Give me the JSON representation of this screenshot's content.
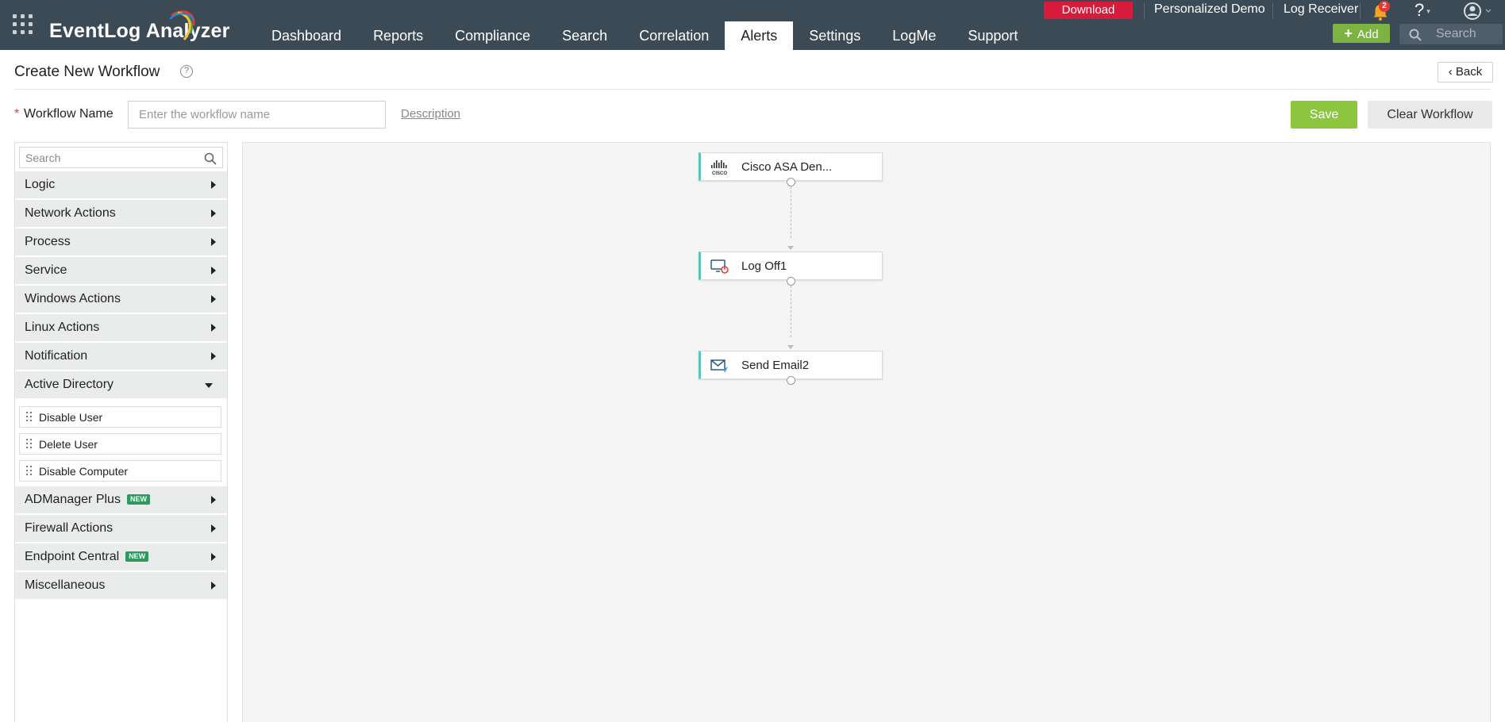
{
  "app": {
    "name": "EventLog Analyzer",
    "accent": "#8cc63f"
  },
  "nav": {
    "tabs": [
      {
        "label": "Dashboard"
      },
      {
        "label": "Reports"
      },
      {
        "label": "Compliance"
      },
      {
        "label": "Search"
      },
      {
        "label": "Correlation"
      },
      {
        "label": "Alerts",
        "active": true
      },
      {
        "label": "Settings"
      },
      {
        "label": "LogMe"
      },
      {
        "label": "Support"
      }
    ]
  },
  "header": {
    "download_label": "Download",
    "personalized_demo": "Personalized Demo",
    "log_receiver": "Log Receiver",
    "notification_count": "2",
    "help_label": "?",
    "add_label": "Add",
    "search_placeholder": "Search"
  },
  "page": {
    "title": "Create New Workflow",
    "help_icon_label": "?",
    "back_label": "Back"
  },
  "form": {
    "required_mark": "*",
    "workflow_name_label": "Workflow Name",
    "workflow_name_value": "",
    "workflow_name_placeholder": "Enter the workflow name",
    "description_link": "Description",
    "save_label": "Save",
    "clear_label": "Clear Workflow"
  },
  "palette": {
    "search_placeholder": "Search",
    "new_badge": "NEW",
    "categories": [
      {
        "label": "Logic",
        "expanded": false
      },
      {
        "label": "Network Actions",
        "expanded": false
      },
      {
        "label": "Process",
        "expanded": false
      },
      {
        "label": "Service",
        "expanded": false
      },
      {
        "label": "Windows Actions",
        "expanded": false
      },
      {
        "label": "Linux Actions",
        "expanded": false
      },
      {
        "label": "Notification",
        "expanded": false
      },
      {
        "label": "Active Directory",
        "expanded": true,
        "items": [
          "Disable User",
          "Delete User",
          "Disable Computer"
        ]
      },
      {
        "label": "ADManager Plus",
        "expanded": false,
        "is_new": true
      },
      {
        "label": "Firewall Actions",
        "expanded": false
      },
      {
        "label": "Endpoint Central",
        "expanded": false,
        "is_new": true
      },
      {
        "label": "Miscellaneous",
        "expanded": false
      }
    ]
  },
  "workflow": {
    "nodes": [
      {
        "label": "Cisco ASA Den...",
        "icon": "cisco-icon"
      },
      {
        "label": "Log Off1",
        "icon": "log-off-icon"
      },
      {
        "label": "Send Email2",
        "icon": "send-email-icon"
      }
    ]
  }
}
